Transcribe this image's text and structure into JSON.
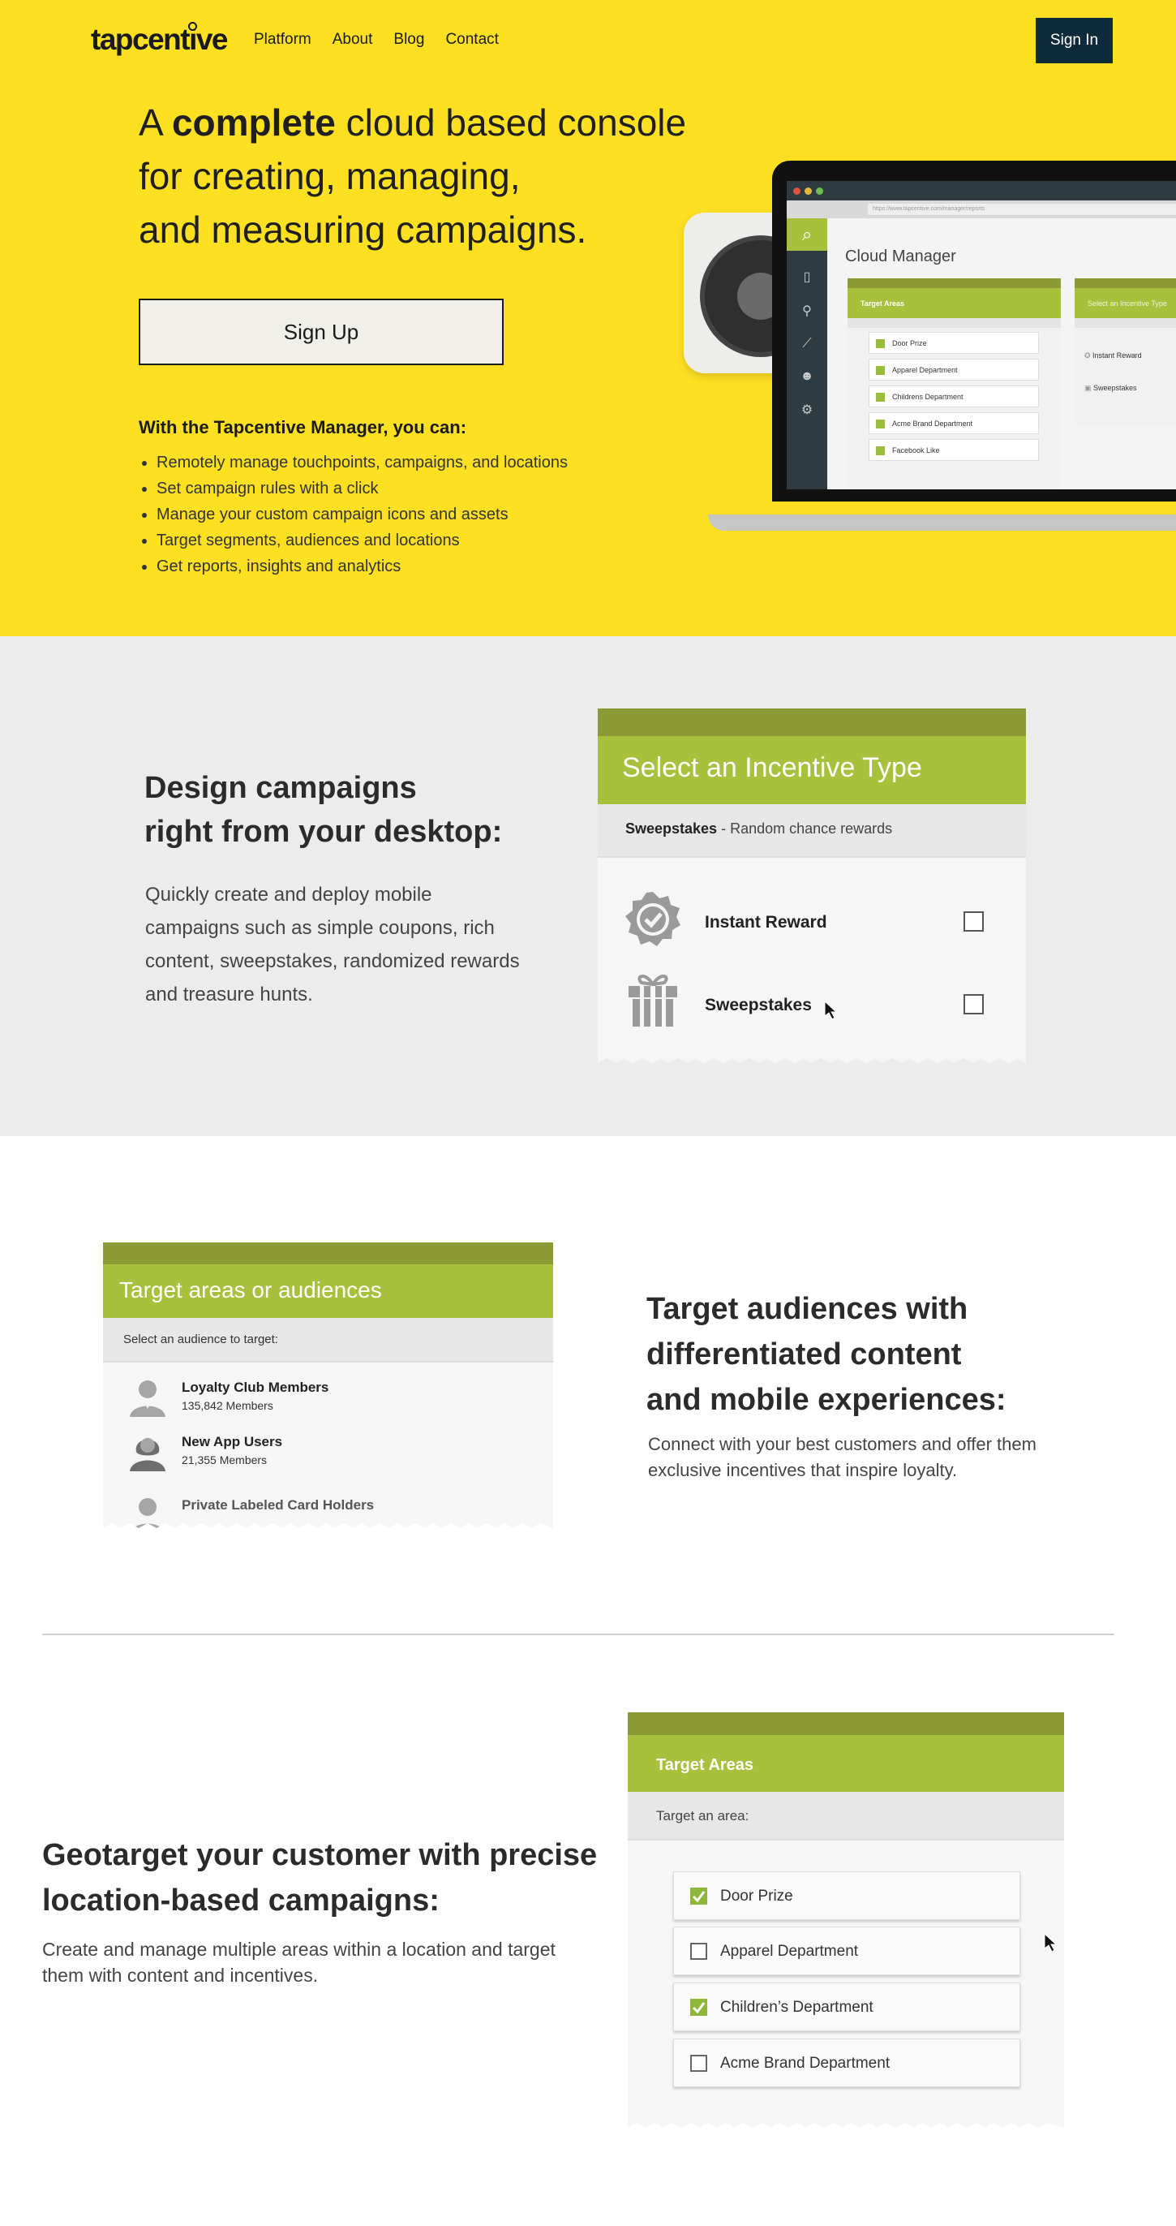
{
  "header": {
    "logo": "tapcentive",
    "nav": [
      "Platform",
      "About",
      "Blog",
      "Contact"
    ],
    "signin_label": "Sign In"
  },
  "hero": {
    "title_pre": "A ",
    "title_bold": "complete",
    "title_line1_rest": " cloud based console",
    "title_line2": "for creating, managing,",
    "title_line3": "and measuring campaigns.",
    "signup_label": "Sign Up",
    "can_title": "With the Tapcentive Manager, you can:",
    "can_items": [
      "Remotely manage touchpoints, campaigns, and locations",
      "Set campaign rules with a click",
      "Manage your custom campaign icons and assets",
      "Target segments, audiences and locations",
      "Get reports, insights and analytics"
    ]
  },
  "laptop": {
    "url": "https://www.tapcentive.com/manager/reports",
    "app_title": "Cloud Manager",
    "panel_title": "Target Areas",
    "panel_items": [
      "Door Prize",
      "Apparel Department",
      "Childrens Department",
      "Acme Brand Department",
      "Facebook Like"
    ],
    "panel2_title": "Select an Incentive Type",
    "panel2_items": [
      "Instant Reward",
      "Sweepstakes"
    ],
    "colors": {
      "accent": "#a8c13d",
      "dark": "#2e3b40"
    }
  },
  "design": {
    "title_line1": "Design campaigns",
    "title_line2": "right from your desktop:",
    "body": "Quickly create and deploy mobile campaigns such as simple coupons, rich content, sweepstakes, randomized rewards and treasure hunts.",
    "card": {
      "title": "Select an Incentive Type",
      "sub_bold": "Sweepstakes",
      "sub_rest": " - Random chance rewards",
      "rows": [
        {
          "label": "Instant Reward",
          "icon": "badge-check-icon"
        },
        {
          "label": "Sweepstakes",
          "icon": "gift-icon"
        }
      ]
    }
  },
  "audiences": {
    "card": {
      "title": "Target areas or audiences",
      "sub": "Select an audience to target:",
      "items": [
        {
          "name": "Loyalty Club Members",
          "count": "135,842 Members",
          "icon": "male-user-icon"
        },
        {
          "name": "New App Users",
          "count": "21,355 Members",
          "icon": "female-user-icon"
        },
        {
          "name": "Private Labeled Card Holders",
          "count": "",
          "icon": "male-user-icon"
        }
      ]
    },
    "title_line1": "Target audiences with",
    "title_line2": "differentiated content",
    "title_line3": "and mobile  experiences:",
    "body": "Connect with your best customers and offer them exclusive incentives that inspire loyalty."
  },
  "geo": {
    "title_line1": "Geotarget your customer with precise",
    "title_line2": "location-based campaigns:",
    "body": "Create and manage multiple areas within a location and target them with content and incentives.",
    "card": {
      "title": "Target Areas",
      "sub": "Target an area:",
      "areas": [
        {
          "label": "Door Prize",
          "checked": true
        },
        {
          "label": "Apparel Department",
          "checked": false
        },
        {
          "label": "Children’s Department",
          "checked": true
        },
        {
          "label": "Acme Brand Department",
          "checked": false
        }
      ]
    }
  }
}
